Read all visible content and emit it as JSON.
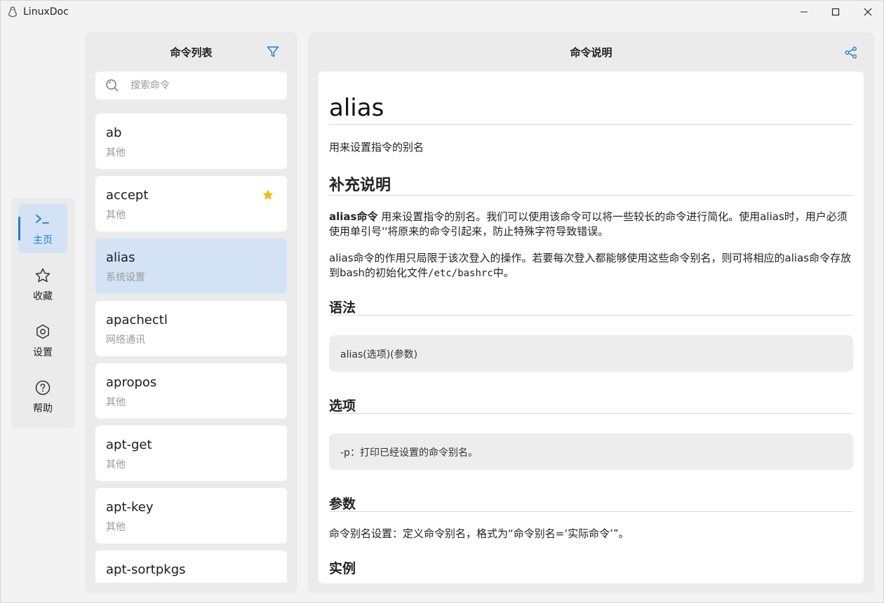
{
  "app": {
    "title": "LinuxDoc",
    "icon": "penguin-icon"
  },
  "window_controls": {
    "minimize": "minimize-icon",
    "maximize": "maximize-icon",
    "close": "close-icon"
  },
  "accent_color": "#1d7fcf",
  "nav": {
    "items": [
      {
        "label": "主页",
        "icon": "terminal-icon",
        "active": true
      },
      {
        "label": "收藏",
        "icon": "star-icon",
        "active": false
      },
      {
        "label": "设置",
        "icon": "gear-icon",
        "active": false
      },
      {
        "label": "帮助",
        "icon": "help-icon",
        "active": false
      }
    ]
  },
  "command_list": {
    "title": "命令列表",
    "filter_icon": "filter-icon",
    "search": {
      "placeholder": "搜索命令",
      "value": ""
    },
    "items": [
      {
        "name": "ab",
        "category": "其他",
        "favorite": false,
        "selected": false
      },
      {
        "name": "accept",
        "category": "其他",
        "favorite": true,
        "selected": false
      },
      {
        "name": "alias",
        "category": "系统设置",
        "favorite": false,
        "selected": true
      },
      {
        "name": "apachectl",
        "category": "网络通讯",
        "favorite": false,
        "selected": false
      },
      {
        "name": "apropos",
        "category": "其他",
        "favorite": false,
        "selected": false
      },
      {
        "name": "apt-get",
        "category": "其他",
        "favorite": false,
        "selected": false
      },
      {
        "name": "apt-key",
        "category": "其他",
        "favorite": false,
        "selected": false
      },
      {
        "name": "apt-sortpkgs",
        "category": "",
        "favorite": false,
        "selected": false
      }
    ]
  },
  "detail": {
    "title": "命令说明",
    "share_icon": "share-icon",
    "doc": {
      "heading": "alias",
      "summary": "用来设置指令的别名",
      "section_supplement": "补充说明",
      "para1_bold": "alias命令",
      "para1_rest": " 用来设置指令的别名。我们可以使用该命令可以将一些较长的命令进行简化。使用alias时，用户必须使用单引号''将原来的命令引起来，防止特殊字符导致错误。",
      "para2_pre": "alias命令的作用只局限于该次登入的操作。若要每次登入都能够使用这些命令别名，则可将相应的alias命令存放到bash的初始化文件",
      "para2_code": "/etc/bashrc",
      "para2_post": "中。",
      "section_syntax": "语法",
      "syntax_code": "alias(选项)(参数)",
      "section_options": "选项",
      "options_code": "-p：打印已经设置的命令别名。",
      "section_params": "参数",
      "params_text": "命令别名设置：定义命令别名，格式为“命令别名=‘实际命令’”。",
      "section_examples": "实例"
    }
  }
}
